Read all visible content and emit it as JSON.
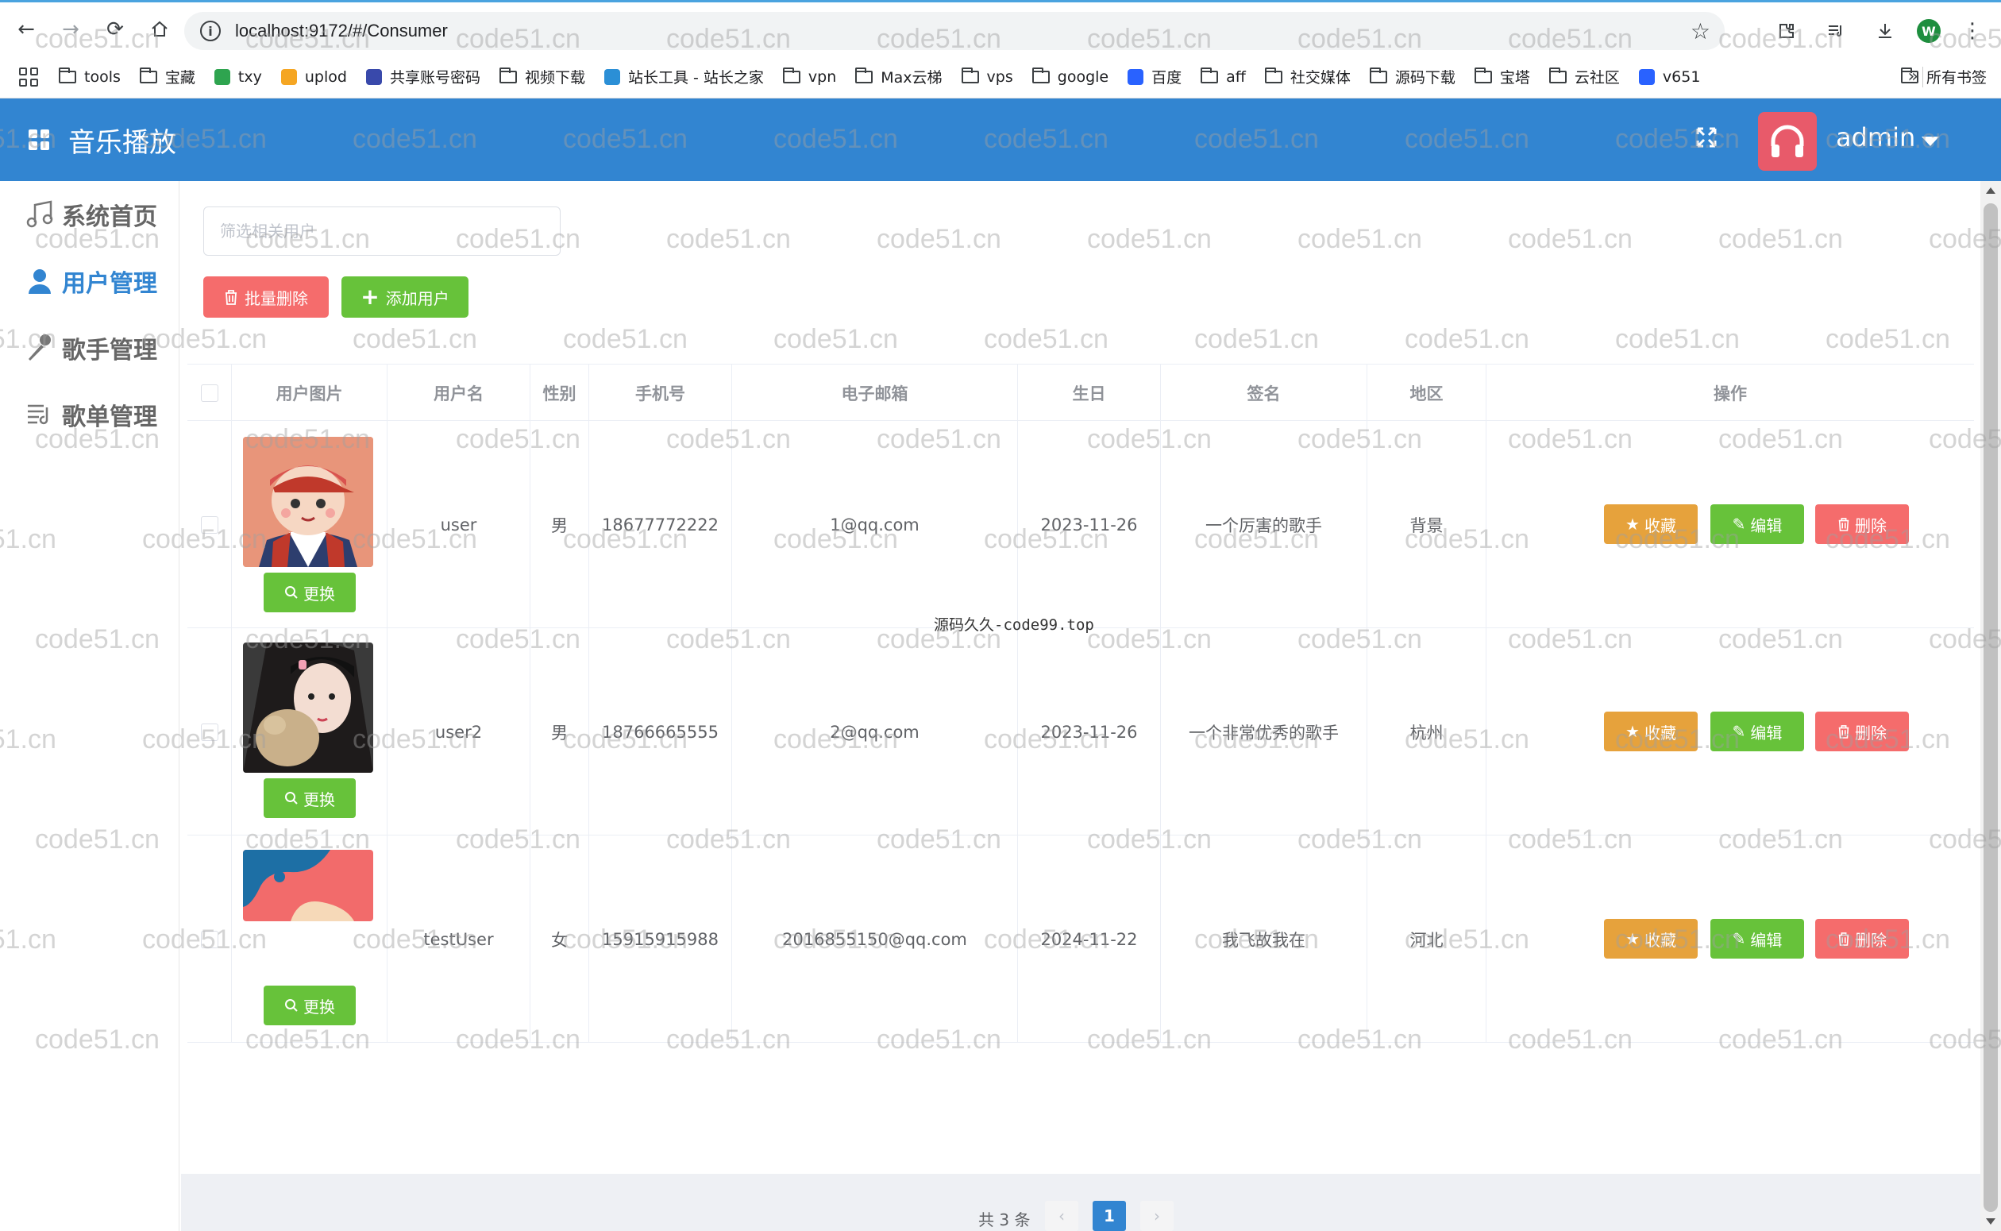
{
  "browser": {
    "url": "localhost:9172/#/Consumer",
    "profile_initial": "W",
    "bookmarks": [
      {
        "label": "tools",
        "type": "folder"
      },
      {
        "label": "宝藏",
        "type": "folder"
      },
      {
        "label": "txy",
        "type": "site"
      },
      {
        "label": "uplod",
        "type": "site"
      },
      {
        "label": "共享账号密码",
        "type": "site"
      },
      {
        "label": "视频下载",
        "type": "folder"
      },
      {
        "label": "站长工具 - 站长之家",
        "type": "site"
      },
      {
        "label": "vpn",
        "type": "folder"
      },
      {
        "label": "Max云梯",
        "type": "folder"
      },
      {
        "label": "vps",
        "type": "folder"
      },
      {
        "label": "google",
        "type": "folder"
      },
      {
        "label": "百度",
        "type": "site"
      },
      {
        "label": "aff",
        "type": "folder"
      },
      {
        "label": "社交媒体",
        "type": "folder"
      },
      {
        "label": "源码下载",
        "type": "folder"
      },
      {
        "label": "宝塔",
        "type": "folder"
      },
      {
        "label": "云社区",
        "type": "folder"
      },
      {
        "label": "v651",
        "type": "site"
      }
    ],
    "bookmarks_more": "»",
    "all_bookmarks": "所有书签"
  },
  "header": {
    "title": "音乐播放",
    "username": "admin"
  },
  "sidebar": {
    "items": [
      {
        "label": "系统首页",
        "icon": "music-note-icon"
      },
      {
        "label": "用户管理",
        "icon": "user-icon"
      },
      {
        "label": "歌手管理",
        "icon": "microphone-icon"
      },
      {
        "label": "歌单管理",
        "icon": "playlist-icon"
      }
    ]
  },
  "toolbar": {
    "search_placeholder": "筛选相关用户",
    "batch_delete": "批量删除",
    "add_user": "添加用户"
  },
  "table": {
    "headers": [
      "用户图片",
      "用户名",
      "性别",
      "手机号",
      "电子邮箱",
      "生日",
      "签名",
      "地区",
      "操作"
    ],
    "change_label": "更换",
    "actions": {
      "collect": "收藏",
      "edit": "编辑",
      "delete": "删除"
    },
    "rows": [
      {
        "username": "user",
        "gender": "男",
        "phone": "18677772222",
        "email": "1@qq.com",
        "birthday": "2023-11-26",
        "signature": "一个厉害的歌手",
        "region": "背景"
      },
      {
        "username": "user2",
        "gender": "男",
        "phone": "18766665555",
        "email": "2@qq.com",
        "birthday": "2023-11-26",
        "signature": "一个非常优秀的歌手",
        "region": "杭州"
      },
      {
        "username": "testUser",
        "gender": "女",
        "phone": "15915915988",
        "email": "2016855150@qq.com",
        "birthday": "2024-11-22",
        "signature": "我飞故我在",
        "region": "河北"
      }
    ]
  },
  "overlay_note": "源码久久-code99.top",
  "pagination": {
    "total": "共 3 条",
    "current_page": "1",
    "prev": "‹",
    "next": "›"
  },
  "watermark": "code51.cn",
  "colors": {
    "header_bg": "#3285d1",
    "danger": "#f56c6c",
    "success": "#67c23a",
    "warning": "#e6a23c",
    "avatar_bg": "#e85a6a"
  }
}
